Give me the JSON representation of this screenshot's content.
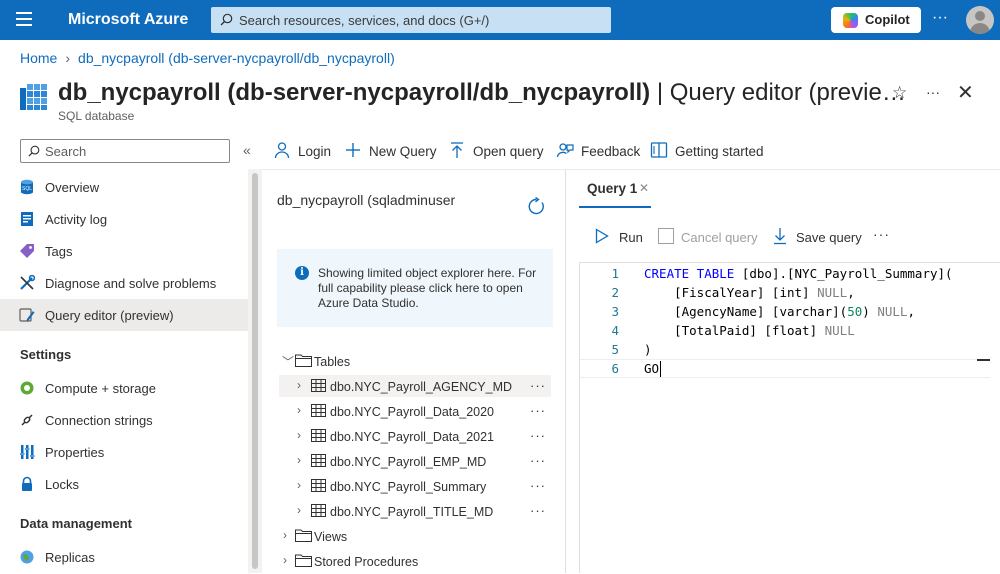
{
  "topbar": {
    "brand": "Microsoft Azure",
    "search_placeholder": "Search resources, services, and docs (G+/)",
    "copilot_label": "Copilot",
    "more": "···"
  },
  "breadcrumb": {
    "items": [
      "Home",
      "db_nycpayroll (db-server-nycpayroll/db_nycpayroll)"
    ]
  },
  "header": {
    "title_main": "db_nycpayroll (db-server-nycpayroll/db_nycpayroll)",
    "title_sep": " | ",
    "title_section": "Query editor (previe…",
    "subtitle": "SQL database",
    "star": "☆",
    "more": "···",
    "close": "✕"
  },
  "sidebar": {
    "search_placeholder": "Search",
    "collapse": "«",
    "items": [
      {
        "label": "Overview",
        "icon": "sql-db-icon"
      },
      {
        "label": "Activity log",
        "icon": "activity-log-icon"
      },
      {
        "label": "Tags",
        "icon": "tag-icon"
      },
      {
        "label": "Diagnose and solve problems",
        "icon": "wrench-icon"
      },
      {
        "label": "Query editor (preview)",
        "icon": "query-editor-icon",
        "active": true
      }
    ],
    "settings_group": "Settings",
    "settings_items": [
      {
        "label": "Compute + storage",
        "icon": "compute-icon"
      },
      {
        "label": "Connection strings",
        "icon": "connection-icon"
      },
      {
        "label": "Properties",
        "icon": "properties-icon"
      },
      {
        "label": "Locks",
        "icon": "lock-icon"
      }
    ],
    "data_group": "Data management",
    "data_items": [
      {
        "label": "Replicas",
        "icon": "globe-icon"
      }
    ]
  },
  "toolbar": {
    "login": "Login",
    "new_query": "New Query",
    "open_query": "Open query",
    "feedback": "Feedback",
    "getting_started": "Getting started"
  },
  "explorer": {
    "title": "db_nycpayroll (sqladminuser",
    "info": "Showing limited object explorer here. For full capability please click here to open Azure Data Studio.",
    "tables_label": "Tables",
    "tables": [
      "dbo.NYC_Payroll_AGENCY_MD",
      "dbo.NYC_Payroll_Data_2020",
      "dbo.NYC_Payroll_Data_2021",
      "dbo.NYC_Payroll_EMP_MD",
      "dbo.NYC_Payroll_Summary",
      "dbo.NYC_Payroll_TITLE_MD"
    ],
    "views_label": "Views",
    "procs_label": "Stored Procedures",
    "more": "···"
  },
  "query": {
    "tab_label": "Query 1",
    "tab_close": "✕",
    "run": "Run",
    "cancel": "Cancel query",
    "save": "Save query",
    "more": "···",
    "line_numbers": [
      "1",
      "2",
      "3",
      "4",
      "5",
      "6"
    ],
    "code": {
      "l1_kw": "CREATE TABLE",
      "l1_rest": " [dbo].[NYC_Payroll_Summary](",
      "l2_a": "    [FiscalYear] [int] ",
      "l2_null": "NULL",
      "l2_b": ",",
      "l3_a": "    [AgencyName] [varchar](",
      "l3_num": "50",
      "l3_b": ") ",
      "l3_null": "NULL",
      "l3_c": ",",
      "l4_a": "    [TotalPaid] [float] ",
      "l4_null": "NULL",
      "l5": ")",
      "l6_kw": "GO"
    }
  },
  "colors": {
    "azure_blue": "#0f6cbd",
    "keyword": "#0000ff",
    "null_gray": "#808080",
    "number": "#098658",
    "line_number": "#237893"
  }
}
